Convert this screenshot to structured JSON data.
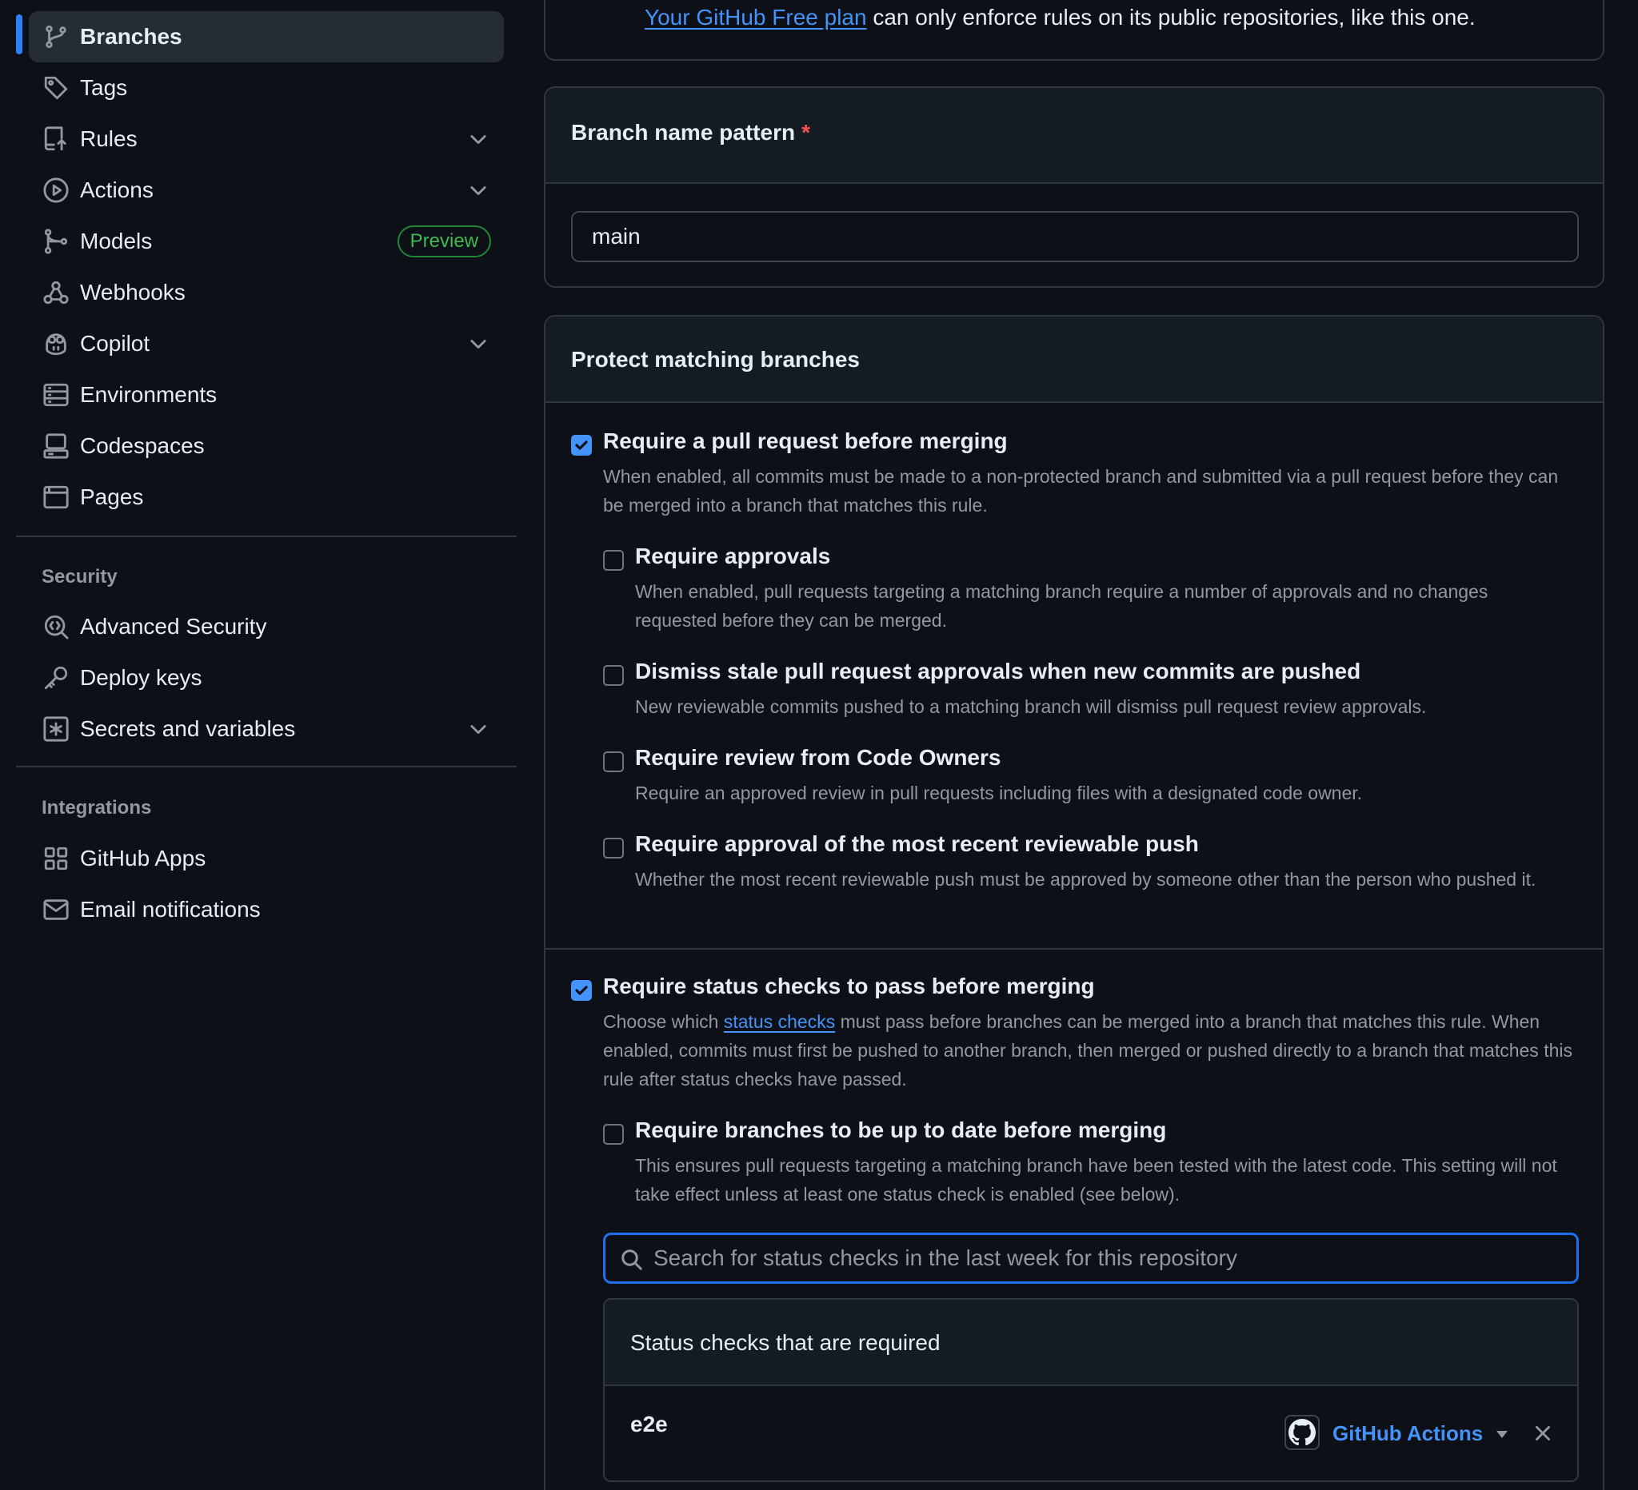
{
  "sidebar": {
    "items": [
      {
        "label": "Branches",
        "icon": "git-branch-icon",
        "active": true
      },
      {
        "label": "Tags",
        "icon": "tag-icon"
      },
      {
        "label": "Rules",
        "icon": "repo-push-icon",
        "expandable": true
      },
      {
        "label": "Actions",
        "icon": "play-icon",
        "expandable": true
      },
      {
        "label": "Models",
        "icon": "models-icon",
        "badge": "Preview"
      },
      {
        "label": "Webhooks",
        "icon": "webhook-icon"
      },
      {
        "label": "Copilot",
        "icon": "copilot-icon",
        "expandable": true
      },
      {
        "label": "Environments",
        "icon": "server-icon"
      },
      {
        "label": "Codespaces",
        "icon": "codespaces-icon"
      },
      {
        "label": "Pages",
        "icon": "browser-icon"
      }
    ],
    "security": {
      "heading": "Security",
      "items": [
        {
          "label": "Advanced Security",
          "icon": "codescan-icon"
        },
        {
          "label": "Deploy keys",
          "icon": "key-icon"
        },
        {
          "label": "Secrets and variables",
          "icon": "asterisk-box-icon",
          "expandable": true
        }
      ]
    },
    "integrations": {
      "heading": "Integrations",
      "items": [
        {
          "label": "GitHub Apps",
          "icon": "apps-icon"
        },
        {
          "label": "Email notifications",
          "icon": "mail-icon"
        }
      ]
    }
  },
  "notice": {
    "link": "Your GitHub Free plan",
    "text": " can only enforce rules on its public repositories, like this one."
  },
  "pattern": {
    "title": "Branch name pattern",
    "required_mark": "*",
    "value": "main"
  },
  "protect": {
    "title": "Protect matching branches",
    "pull_request": {
      "checked": true,
      "label": "Require a pull request before merging",
      "desc": "When enabled, all commits must be made to a non-protected branch and submitted via a pull request before they can be merged into a branch that matches this rule.",
      "sub": [
        {
          "checked": false,
          "label": "Require approvals",
          "desc": "When enabled, pull requests targeting a matching branch require a number of approvals and no changes requested before they can be merged."
        },
        {
          "checked": false,
          "label": "Dismiss stale pull request approvals when new commits are pushed",
          "desc": "New reviewable commits pushed to a matching branch will dismiss pull request review approvals."
        },
        {
          "checked": false,
          "label": "Require review from Code Owners",
          "desc": "Require an approved review in pull requests including files with a designated code owner."
        },
        {
          "checked": false,
          "label": "Require approval of the most recent reviewable push",
          "desc": "Whether the most recent reviewable push must be approved by someone other than the person who pushed it."
        }
      ]
    },
    "status_checks": {
      "checked": true,
      "label": "Require status checks to pass before merging",
      "desc_before": "Choose which ",
      "desc_link": "status checks",
      "desc_after": " must pass before branches can be merged into a branch that matches this rule. When enabled, commits must first be pushed to another branch, then merged or pushed directly to a branch that matches this rule after status checks have passed.",
      "up_to_date": {
        "checked": false,
        "label": "Require branches to be up to date before merging",
        "desc": "This ensures pull requests targeting a matching branch have been tested with the latest code. This setting will not take effect unless at least one status check is enabled (see below)."
      },
      "search_placeholder": "Search for status checks in the last week for this repository",
      "required_title": "Status checks that are required",
      "required": [
        {
          "name": "e2e",
          "app": "GitHub Actions"
        }
      ]
    }
  },
  "colors": {
    "accent": "#4493f8",
    "background": "#0d1117",
    "border": "#30363d",
    "badge_green": "#3fb950",
    "danger": "#f85149"
  }
}
